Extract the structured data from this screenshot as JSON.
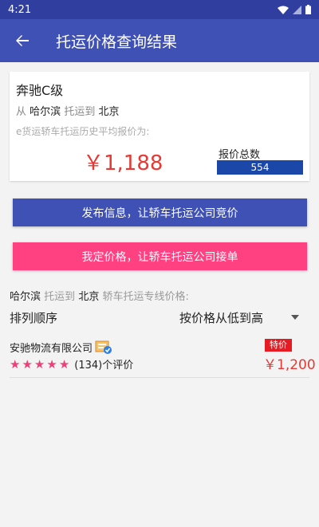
{
  "status_bar": {
    "time": "4:21"
  },
  "app_bar": {
    "title": "托运价格查询结果"
  },
  "summary": {
    "car_model": "奔驰C级",
    "route_from_prefix": "从",
    "from_city": "哈尔滨",
    "route_mid": "托运到",
    "to_city": "北京",
    "avg_label": "e货运轿车托运历史平均报价为:",
    "avg_price": "￥1,188",
    "total_label": "报价总数",
    "total_count": "554"
  },
  "buttons": {
    "publish": "发布信息，让轿车托运公司竞价",
    "fixed_price": "我定价格，让轿车托运公司接单"
  },
  "line_section": {
    "from_city": "哈尔滨",
    "mid": "托运到",
    "to_city": "北京",
    "suffix": "轿车托运专线价格:"
  },
  "sort": {
    "label": "排列顺序",
    "selected": "按价格从低到高"
  },
  "companies": [
    {
      "name": "安驰物流有限公司",
      "rating_stars": 5,
      "reviews": "(134)个评价",
      "tag": "特价",
      "price": "￥1,200"
    }
  ],
  "colors": {
    "primary": "#3f51b5",
    "primary_dark": "#303f9f",
    "accent": "#ff4081",
    "price_red": "#e53935",
    "count_blue": "#1a47a8"
  }
}
